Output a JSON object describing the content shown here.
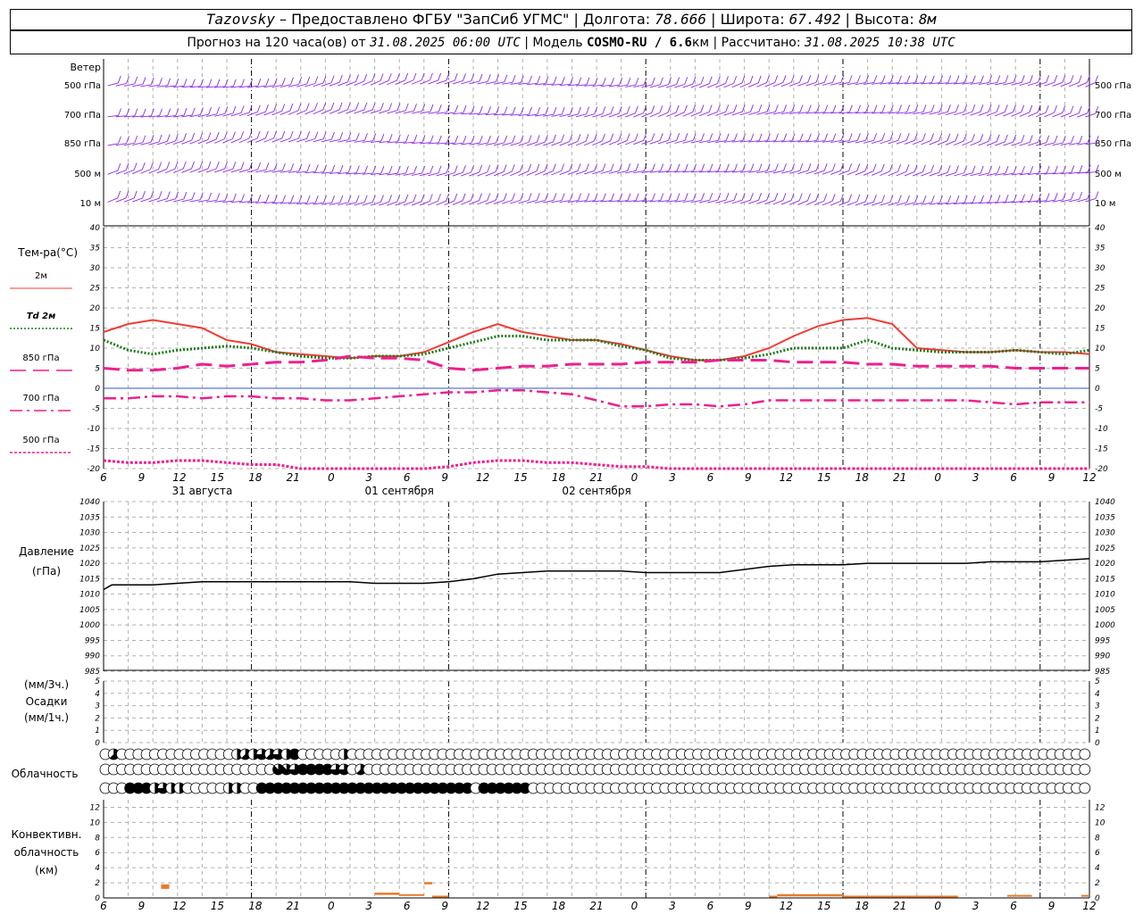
{
  "header": {
    "station": "Tazovsky",
    "dash": " – ",
    "provider": "Предоставлено ФГБУ \"ЗапСиб УГМС\"",
    "sep": " | ",
    "lon_label": "Долгота: ",
    "lon_value": "78.666",
    "lat_label": "Широта: ",
    "lat_value": "67.492",
    "alt_label": "Высота: ",
    "alt_value": "8м"
  },
  "subheader": {
    "forecast_prefix": "Прогноз на 120 часа(ов) от ",
    "init_time": "31.08.2025 06:00 UTC",
    "model_prefix": "  | Модель ",
    "model": "COSMO-RU / 6.6",
    "model_unit": "км",
    "calc_prefix": " | Рассчитано: ",
    "calc_time": "31.08.2025 10:38 UTC"
  },
  "colors": {
    "wind": "#8a2be2",
    "t2m": "#f03c32",
    "td2m": "#1e7a1e",
    "t850": "#ee1f8e",
    "t700": "#ee1f8e",
    "t500": "#ee1f8e",
    "pressure": "#000000",
    "conv": "#e87b2a",
    "grid": "#b0b0b0"
  },
  "chart_data": [
    {
      "type": "wind-barbs",
      "panel_label": "Ветер",
      "levels": [
        "500 гПа",
        "700 гПа",
        "850 гПа",
        "500 м",
        "10 м"
      ]
    },
    {
      "type": "line",
      "panel_label": "Тем-ра(°C)",
      "ylim": [
        -20,
        40
      ],
      "yticks": [
        -20,
        -15,
        -10,
        -5,
        0,
        5,
        10,
        15,
        20,
        25,
        30,
        35,
        40
      ],
      "x_hours": [
        0,
        3,
        6,
        9,
        12,
        15,
        18,
        21,
        24,
        27,
        30,
        33,
        36,
        39,
        42,
        45,
        48,
        51,
        54,
        57,
        60,
        63,
        66,
        69,
        72,
        75,
        78,
        81,
        84,
        87,
        90,
        93,
        96,
        99,
        102,
        105,
        108,
        111,
        114,
        117,
        120
      ],
      "xtick_labels": [
        "6",
        "9",
        "12",
        "15",
        "18",
        "21",
        "0",
        "3",
        "6",
        "9",
        "12",
        "15",
        "18",
        "21",
        "0",
        "3",
        "6",
        "9",
        "12",
        "15",
        "18",
        "21",
        "0",
        "3",
        "6",
        "9",
        "12"
      ],
      "date_labels": [
        "31 августа",
        "01 сентября",
        "02 сентября"
      ],
      "series": [
        {
          "name": "2м",
          "style": "solid",
          "values": [
            14,
            16,
            17,
            16,
            15,
            12,
            11,
            9,
            8.5,
            8,
            7.5,
            8,
            8,
            9,
            11.5,
            14,
            16,
            14,
            13,
            12,
            12,
            11,
            9.5,
            8,
            7,
            7,
            8,
            10,
            13,
            15.5,
            17,
            17.5,
            16,
            10,
            9.5,
            9,
            9,
            9.5,
            9,
            9,
            8.5
          ]
        },
        {
          "name": "Td 2м",
          "style": "dotted",
          "values": [
            12,
            9.5,
            8.5,
            9.5,
            10,
            10.5,
            10,
            9,
            8,
            7.5,
            7.5,
            8,
            8,
            8.5,
            10,
            11.5,
            13,
            13,
            12,
            12,
            12,
            10.5,
            9.5,
            7.5,
            7,
            7,
            7.5,
            8.5,
            10,
            10,
            10,
            12,
            10,
            9.5,
            9,
            9,
            9,
            9.5,
            9,
            8.5,
            9.5
          ]
        },
        {
          "name": "850 гПа",
          "style": "longdash",
          "values": [
            5,
            4.5,
            4.5,
            5,
            6,
            5.5,
            6,
            6.5,
            6.5,
            7,
            8,
            7.5,
            7.5,
            7,
            5,
            4.5,
            5,
            5.5,
            5.5,
            6,
            6,
            6,
            6.5,
            6.5,
            6.5,
            7,
            7,
            7,
            6.5,
            6.5,
            6.5,
            6,
            6,
            5.5,
            5.5,
            5.5,
            5.5,
            5,
            5,
            5,
            5
          ]
        },
        {
          "name": "700 гПа",
          "style": "dashdot",
          "values": [
            -2.5,
            -2.5,
            -2,
            -2,
            -2.5,
            -2,
            -2,
            -2.5,
            -2.5,
            -3,
            -3,
            -2.5,
            -2,
            -1.5,
            -1,
            -1,
            -0.5,
            -0.5,
            -1,
            -1.5,
            -3,
            -4.5,
            -4.5,
            -4,
            -4,
            -4.5,
            -4,
            -3,
            -3,
            -3,
            -3,
            -3,
            -3,
            -3,
            -3,
            -3,
            -3.5,
            -4,
            -3.5,
            -3.5,
            -3.5
          ]
        },
        {
          "name": "500 гПа",
          "style": "dotted",
          "values": [
            -18,
            -18.5,
            -18.5,
            -18,
            -18,
            -18.5,
            -19,
            -19,
            -20,
            -20.5,
            -21,
            -21,
            -21,
            -20.5,
            -19.5,
            -18.5,
            -18,
            -18,
            -18.5,
            -18.5,
            -19,
            -19.5,
            -19.5,
            -20,
            -20.5,
            -21,
            -21,
            -21,
            -21,
            -21,
            -21,
            -21,
            -21,
            -21,
            -21,
            -21,
            -21,
            -21,
            -21,
            -21,
            -21
          ]
        }
      ]
    },
    {
      "type": "line",
      "panel_label_1": "Давление",
      "panel_label_2": "(гПа)",
      "ylim": [
        985,
        1040
      ],
      "yticks": [
        985,
        990,
        995,
        1000,
        1005,
        1010,
        1015,
        1020,
        1025,
        1030,
        1035,
        1040
      ],
      "x_hours": [
        0,
        1,
        3,
        6,
        9,
        12,
        15,
        18,
        21,
        24,
        27,
        30,
        33,
        36,
        39,
        42,
        45,
        48,
        51,
        54,
        57,
        60,
        63,
        66,
        69,
        72,
        75,
        78,
        81,
        84,
        87,
        90,
        93,
        96,
        99,
        102,
        105,
        108,
        111,
        114,
        117,
        120
      ],
      "series": [
        {
          "name": "Давление",
          "values": [
            1011.5,
            1013,
            1013,
            1013,
            1013.5,
            1014,
            1014,
            1014,
            1014,
            1014,
            1014,
            1014,
            1013.5,
            1013.5,
            1013.5,
            1014,
            1015,
            1016.5,
            1017,
            1017.5,
            1017.5,
            1017.5,
            1017.5,
            1017,
            1017,
            1017,
            1017,
            1018,
            1019,
            1019.5,
            1019.5,
            1019.5,
            1020,
            1020,
            1020,
            1020,
            1020,
            1020.5,
            1020.5,
            1020.5,
            1021,
            1021.5
          ]
        }
      ]
    },
    {
      "type": "bar",
      "panel_label_1": "(мм/3ч.)",
      "panel_label_2": "Осадки",
      "panel_label_3": "(мм/1ч.)",
      "ylim": [
        0,
        5
      ],
      "yticks": [
        0,
        1,
        2,
        3,
        4,
        5
      ],
      "series": [
        {
          "name": "Осадки",
          "values": []
        }
      ]
    },
    {
      "type": "table",
      "panel_label": "Облачность",
      "note": "Cloud cover in eighths, one symbol per hour; rows: upper, middle, low",
      "rows": [
        [
          0,
          5,
          0,
          0,
          0,
          0,
          0,
          0,
          0,
          0,
          0,
          0,
          0,
          0,
          0,
          0,
          4,
          5,
          4,
          6,
          5,
          6,
          4,
          8,
          0,
          0,
          0,
          0,
          0,
          4,
          0,
          0,
          0,
          0,
          0,
          0,
          0,
          0,
          0,
          0,
          0,
          0,
          0,
          0,
          0,
          0,
          0,
          0,
          0,
          0,
          0,
          0,
          0,
          0,
          0,
          0,
          0,
          0,
          0,
          0,
          0,
          0,
          0,
          0,
          0,
          0,
          0,
          0,
          0,
          0,
          0,
          0,
          0,
          0,
          0,
          0,
          0,
          0,
          0,
          0,
          0,
          0,
          0,
          0,
          0,
          0,
          0,
          0,
          0,
          0,
          0,
          0,
          0,
          0,
          0,
          0,
          0,
          0,
          0,
          0,
          0,
          0,
          0,
          0,
          0,
          0,
          0,
          0,
          0,
          0,
          0,
          0,
          0,
          0,
          0,
          0,
          0,
          0,
          0,
          0
        ],
        [
          0,
          0,
          0,
          0,
          0,
          0,
          0,
          0,
          0,
          0,
          0,
          0,
          0,
          0,
          0,
          0,
          0,
          0,
          0,
          0,
          0,
          7,
          7,
          6,
          8,
          8,
          8,
          8,
          6,
          6,
          0,
          5,
          0,
          0,
          0,
          0,
          0,
          0,
          0,
          0,
          0,
          0,
          0,
          0,
          0,
          0,
          0,
          0,
          0,
          0,
          0,
          0,
          0,
          0,
          0,
          0,
          0,
          0,
          0,
          0,
          0,
          0,
          0,
          0,
          0,
          0,
          0,
          0,
          0,
          0,
          0,
          0,
          0,
          0,
          0,
          0,
          0,
          0,
          0,
          0,
          0,
          0,
          0,
          0,
          0,
          0,
          0,
          0,
          0,
          0,
          0,
          0,
          0,
          0,
          0,
          0,
          0,
          0,
          0,
          0,
          0,
          0,
          0,
          0,
          0,
          0,
          0,
          0,
          0,
          0,
          0,
          0,
          0,
          0,
          0,
          0,
          0,
          0,
          0,
          0
        ],
        [
          0,
          0,
          0,
          8,
          8,
          8,
          4,
          6,
          4,
          4,
          0,
          0,
          0,
          0,
          0,
          4,
          4,
          0,
          0,
          8,
          8,
          8,
          8,
          8,
          8,
          8,
          8,
          8,
          8,
          8,
          8,
          8,
          8,
          8,
          8,
          8,
          8,
          8,
          8,
          8,
          8,
          8,
          8,
          8,
          8,
          0,
          8,
          8,
          8,
          8,
          8,
          8,
          0,
          0,
          0,
          0,
          0,
          0,
          0,
          0,
          0,
          0,
          0,
          0,
          0,
          0,
          0,
          0,
          0,
          0,
          0,
          0,
          0,
          0,
          0,
          0,
          0,
          0,
          0,
          0,
          0,
          0,
          0,
          0,
          0,
          0,
          0,
          0,
          0,
          0,
          0,
          0,
          0,
          0,
          0,
          0,
          0,
          0,
          0,
          0,
          0,
          0,
          0,
          0,
          0,
          0,
          0,
          0,
          0,
          0,
          0,
          0,
          0,
          0,
          0,
          0,
          0,
          0,
          0,
          0
        ]
      ]
    },
    {
      "type": "bar",
      "panel_label_1": "Конвективн.",
      "panel_label_2": "облачность",
      "panel_label_3": "(км)",
      "ylim": [
        0,
        13
      ],
      "yticks": [
        0,
        2,
        4,
        6,
        8,
        10,
        12
      ],
      "series": [
        {
          "name": "Конвективная облачность",
          "segments": [
            {
              "start_h": 7,
              "end_h": 8,
              "bottom_km": 1.2,
              "top_km": 1.8
            },
            {
              "start_h": 33,
              "end_h": 36,
              "bottom_km": 0.4,
              "top_km": 0.7
            },
            {
              "start_h": 36,
              "end_h": 39,
              "bottom_km": 0.3,
              "top_km": 0.5
            },
            {
              "start_h": 39,
              "end_h": 40,
              "bottom_km": 1.8,
              "top_km": 2.1
            },
            {
              "start_h": 40,
              "end_h": 42,
              "bottom_km": 0.2,
              "top_km": 0.3
            },
            {
              "start_h": 81,
              "end_h": 82,
              "bottom_km": 0.1,
              "top_km": 0.3
            },
            {
              "start_h": 82,
              "end_h": 90,
              "bottom_km": 0.2,
              "top_km": 0.5
            },
            {
              "start_h": 90,
              "end_h": 93,
              "bottom_km": 0.1,
              "top_km": 0.3
            },
            {
              "start_h": 93,
              "end_h": 104,
              "bottom_km": 0.1,
              "top_km": 0.3
            },
            {
              "start_h": 110,
              "end_h": 113,
              "bottom_km": 0.2,
              "top_km": 0.4
            },
            {
              "start_h": 119,
              "end_h": 120,
              "bottom_km": 0.2,
              "top_km": 0.4
            }
          ]
        }
      ]
    }
  ]
}
